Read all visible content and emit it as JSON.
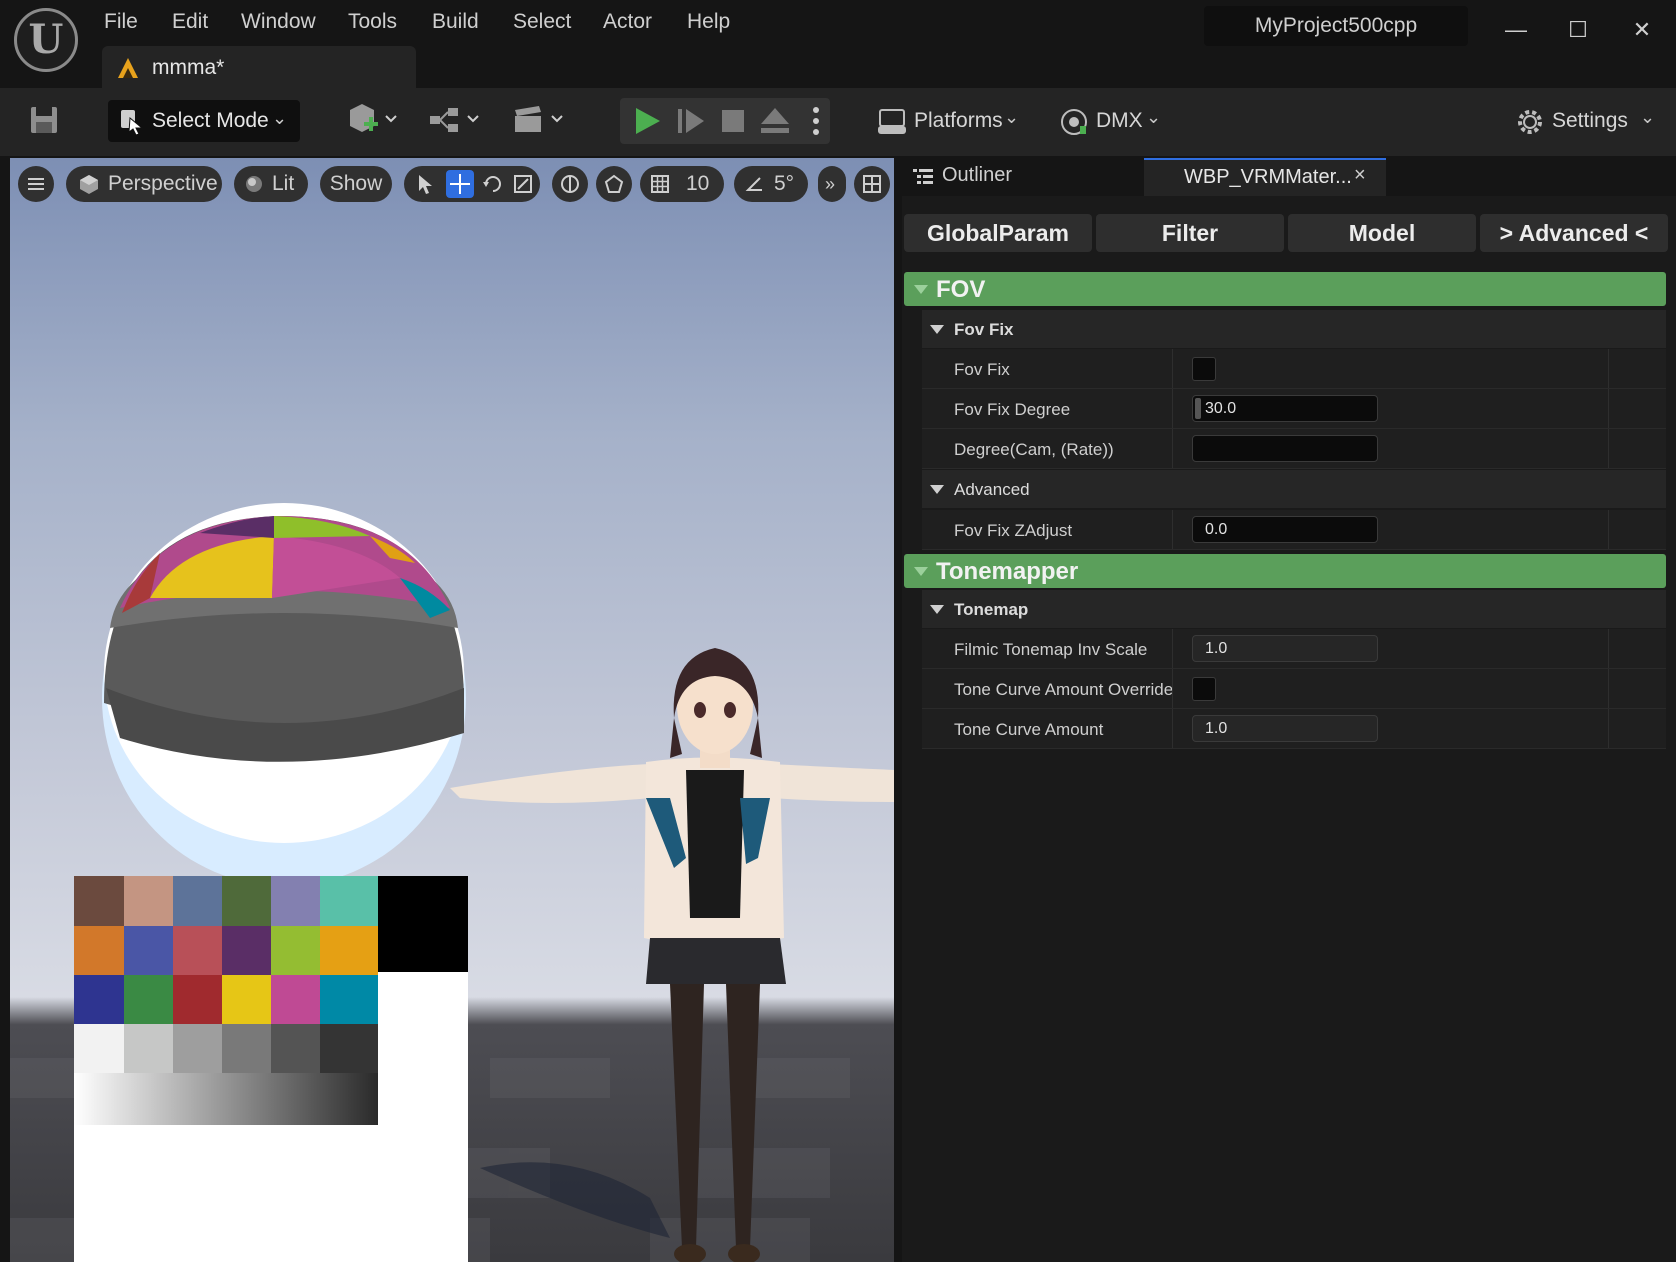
{
  "window": {
    "logo": "U",
    "project_name": "MyProject500cpp",
    "minimize": "—",
    "maximize": "☐",
    "close": "✕"
  },
  "menu": [
    "File",
    "Edit",
    "Window",
    "Tools",
    "Build",
    "Select",
    "Actor",
    "Help"
  ],
  "level_tab": {
    "label": "mmma*",
    "icon": "level-icon"
  },
  "toolbar": {
    "select_mode": "Select Mode",
    "platforms": "Platforms",
    "dmx": "DMX",
    "settings": "Settings"
  },
  "viewport": {
    "perspective": "Perspective",
    "lit": "Lit",
    "show": "Show",
    "grid_snap": "10",
    "rotation_snap": "5°"
  },
  "panel": {
    "tabs": {
      "outliner": "Outliner",
      "widget": "WBP_VRMMater...",
      "close": "×"
    },
    "categories": [
      "GlobalParam",
      "Filter",
      "Model",
      "> Advanced <"
    ],
    "fov": {
      "title": "FOV",
      "group_fovfix": "Fov Fix",
      "fov_fix_label": "Fov Fix",
      "fov_fix_degree_label": "Fov Fix Degree",
      "fov_fix_degree_value": "30.0",
      "degree_cam_label": "Degree(Cam, (Rate))",
      "degree_cam_value": "",
      "group_advanced": "Advanced",
      "zadjust_label": "Fov Fix ZAdjust",
      "zadjust_value": "0.0"
    },
    "tonemapper": {
      "title": "Tonemapper",
      "group_tonemap": "Tonemap",
      "inv_scale_label": "Filmic Tonemap Inv Scale",
      "inv_scale_value": "1.0",
      "override_label": "Tone Curve Amount Override",
      "amount_label": "Tone Curve Amount",
      "amount_value": "1.0"
    }
  },
  "colors": {
    "section_green": "#5b9f5b",
    "play_green": "#4caf50",
    "accent_blue": "#2f6ee0"
  }
}
